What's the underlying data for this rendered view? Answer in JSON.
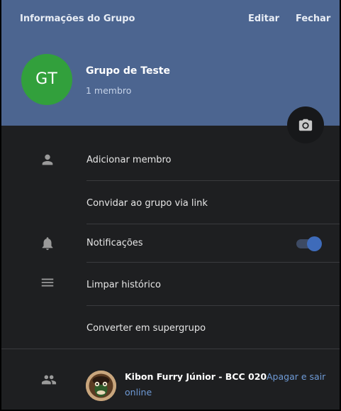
{
  "header": {
    "title": "Informações do Grupo",
    "edit_label": "Editar",
    "close_label": "Fechar",
    "bg_color": "#4c6590"
  },
  "group": {
    "initials": "GT",
    "name": "Grupo de Teste",
    "member_count": "1 membro",
    "avatar_color": "#32a03c"
  },
  "actions": [
    {
      "label": "Adicionar membro",
      "icon": "person-icon"
    },
    {
      "label": "Convidar ao grupo via link",
      "icon": ""
    },
    {
      "label": "Notificações",
      "icon": "bell-icon",
      "toggle_on": true
    },
    {
      "label": "Limpar histórico",
      "icon": "menu-lines-icon"
    },
    {
      "label": "Converter em supergrupo",
      "icon": ""
    }
  ],
  "members": [
    {
      "name": "Kibon Furry Júnior - BCC 020",
      "status": "online",
      "action": "Apagar e sair",
      "icon": "people-icon"
    }
  ],
  "colors": {
    "panel_bg": "#1e1f21",
    "accent": "#3e6bba",
    "link": "#6e9ad6"
  }
}
